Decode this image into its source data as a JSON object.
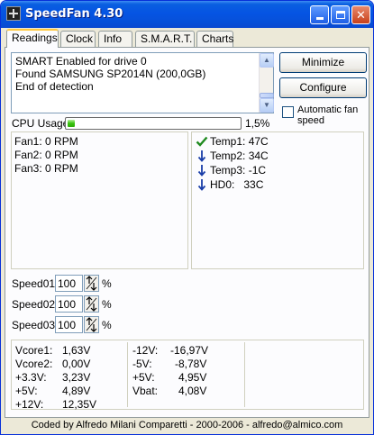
{
  "window": {
    "title": "SpeedFan 4.30"
  },
  "tabs": [
    {
      "label": "Readings"
    },
    {
      "label": "Clock"
    },
    {
      "label": "Info"
    },
    {
      "label": "S.M.A.R.T."
    },
    {
      "label": "Charts"
    }
  ],
  "log": {
    "lines": [
      "SMART Enabled for drive 0",
      "Found SAMSUNG SP2014N (200,0GB)",
      "End of detection"
    ]
  },
  "buttons": {
    "minimize": "Minimize",
    "configure": "Configure"
  },
  "auto_fan": {
    "label": "Automatic fan speed",
    "checked": false
  },
  "cpu": {
    "label": "CPU Usage",
    "value": "1,5%",
    "fraction": 0.015
  },
  "fans": [
    "Fan1: 0 RPM",
    "Fan2: 0 RPM",
    "Fan3: 0 RPM"
  ],
  "temps": [
    {
      "label": "Temp1:",
      "value": "47C",
      "icon": "check-icon"
    },
    {
      "label": "Temp2:",
      "value": "34C",
      "icon": "arrow-down-icon"
    },
    {
      "label": "Temp3:",
      "value": "-1C",
      "icon": "arrow-down-icon"
    },
    {
      "label": "HD0:",
      "value": "33C",
      "icon": "arrow-down-icon"
    }
  ],
  "speeds": [
    {
      "label": "Speed01:",
      "value": "100",
      "unit": "%"
    },
    {
      "label": "Speed02:",
      "value": "100",
      "unit": "%"
    },
    {
      "label": "Speed03:",
      "value": "100",
      "unit": "%"
    }
  ],
  "voltages": {
    "col1": [
      {
        "name": "Vcore1:",
        "value": "1,63V"
      },
      {
        "name": "Vcore2:",
        "value": "0,00V"
      },
      {
        "name": "+3.3V:",
        "value": "3,23V"
      },
      {
        "name": "+5V:",
        "value": "4,89V"
      },
      {
        "name": "+12V:",
        "value": "12,35V"
      }
    ],
    "col2": [
      {
        "name": "-12V:",
        "value": "-16,97V"
      },
      {
        "name": "-5V:",
        "value": "-8,78V"
      },
      {
        "name": "+5V:",
        "value": "4,95V"
      },
      {
        "name": "Vbat:",
        "value": "4,08V"
      }
    ]
  },
  "footer": "Coded by Alfredo Milani Comparetti - 2000-2006 - alfredo@almico.com",
  "colors": {
    "check": "#1f8a1f",
    "arrow": "#1a3ea8",
    "progress": "#37c30d"
  }
}
